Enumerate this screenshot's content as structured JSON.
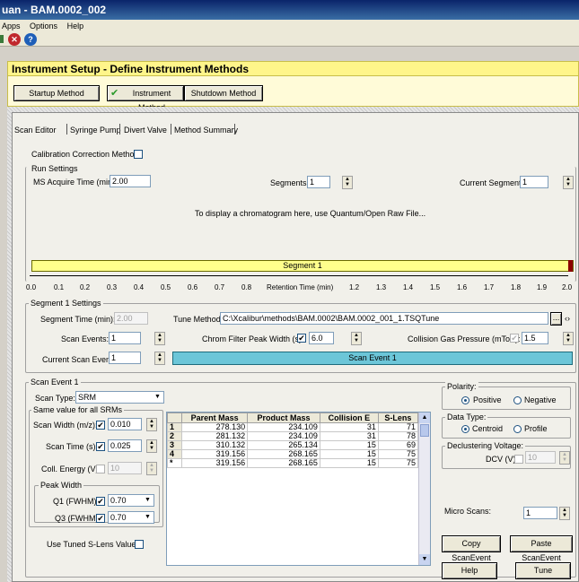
{
  "window": {
    "title": "uan - BAM.0002_002"
  },
  "menu": [
    "Apps",
    "Options",
    "Help"
  ],
  "header": {
    "title": "Instrument Setup - Define Instrument Methods",
    "buttons": {
      "startup": "Startup Method",
      "instrument": "Instrument Method",
      "shutdown": "Shutdown Method"
    }
  },
  "tabs": [
    "Scan Editor",
    "Syringe Pump",
    "Divert Valve",
    "Method Summary"
  ],
  "calibration": {
    "label": "Calibration Correction Method"
  },
  "run_settings": {
    "title": "Run Settings",
    "acquire_time_label": "MS Acquire Time (min):",
    "acquire_time_value": "2.00",
    "segments_label": "Segments:",
    "segments_value": "1",
    "current_segment_label": "Current Segment:",
    "current_segment_value": "1",
    "chromatogram_msg": "To display a chromatogram here, use Quantum/Open Raw File...",
    "segment_bar_label": "Segment 1",
    "axis_ticks": [
      "0.0",
      "0.1",
      "0.2",
      "0.3",
      "0.4",
      "0.5",
      "0.6",
      "0.7",
      "0.8",
      "Retention Time (min)",
      "1.2",
      "1.3",
      "1.4",
      "1.5",
      "1.6",
      "1.7",
      "1.8",
      "1.9",
      "2.0"
    ]
  },
  "segment1": {
    "title": "Segment 1 Settings",
    "segment_time_label": "Segment Time (min):",
    "segment_time_value": "2.00",
    "tune_method_label": "Tune Method",
    "tune_method_value": "C:\\Xcalibur\\methods\\BAM.0002\\BAM.0002_001_1.TSQTune",
    "browse_label": "...",
    "scan_events_label": "Scan Events:",
    "scan_events_value": "1",
    "chrom_filter_label": "Chrom Filter Peak Width (s):",
    "chrom_filter_value": "6.0",
    "collision_gas_label": "Collision Gas Pressure (mTorr):",
    "collision_gas_value": "1.5",
    "current_scan_event_label": "Current Scan Event:",
    "current_scan_event_value": "1",
    "scan_event_bar_label": "Scan Event 1"
  },
  "scan_event": {
    "title": "Scan Event 1",
    "scan_type_label": "Scan Type:",
    "scan_type_value": "SRM",
    "same_value_title": "Same value for all SRMs",
    "scan_width_label": "Scan Width (m/z):",
    "scan_width_value": "0.010",
    "scan_time_label": "Scan Time (s):",
    "scan_time_value": "0.025",
    "coll_energy_label": "Coll. Energy (V):",
    "coll_energy_value": "10",
    "peak_width_title": "Peak Width",
    "q1_label": "Q1 (FWHM):",
    "q1_value": "0.70",
    "q3_label": "Q3 (FWHM):",
    "q3_value": "0.70",
    "use_tuned_label": "Use Tuned S-Lens Value"
  },
  "srm_table": {
    "headers": [
      "Parent Mass",
      "Product Mass",
      "Collision E",
      "S-Lens"
    ],
    "rows": [
      {
        "id": "1",
        "cells": [
          "278.130",
          "234.109",
          "31",
          "71"
        ]
      },
      {
        "id": "2",
        "cells": [
          "281.132",
          "234.109",
          "31",
          "78"
        ]
      },
      {
        "id": "3",
        "cells": [
          "310.132",
          "265.134",
          "15",
          "69"
        ]
      },
      {
        "id": "4",
        "cells": [
          "319.156",
          "268.165",
          "15",
          "75"
        ]
      },
      {
        "id": "*",
        "cells": [
          "319.156",
          "268.165",
          "15",
          "75"
        ]
      }
    ]
  },
  "polarity": {
    "title": "Polarity:",
    "positive": "Positive",
    "negative": "Negative"
  },
  "data_type": {
    "title": "Data Type:",
    "centroid": "Centroid",
    "profile": "Profile"
  },
  "declustering": {
    "title": "Declustering Voltage:",
    "dcv_label": "DCV (V):",
    "dcv_value": "10"
  },
  "micro_scans": {
    "label": "Micro Scans:",
    "value": "1"
  },
  "actions": {
    "copy": "Copy ScanEvent",
    "paste": "Paste ScanEvent",
    "help": "Help",
    "tune": "Tune"
  }
}
